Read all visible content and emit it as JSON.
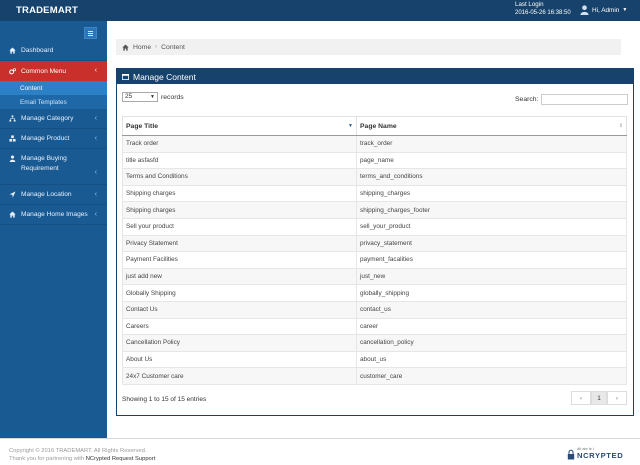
{
  "app": {
    "brand": "TRADEMART"
  },
  "header": {
    "last_login_label": "Last Login",
    "last_login_time": "2016-05-26 16:38:50",
    "user_label": "Hi, Admin"
  },
  "sidebar": {
    "items": [
      {
        "label": "Dashboard",
        "icon": "home-icon"
      },
      {
        "label": "Common Menu",
        "icon": "cogs-icon",
        "active": true,
        "children": [
          {
            "label": "Content"
          },
          {
            "label": "Email Templates"
          }
        ]
      },
      {
        "label": "Manage Category",
        "icon": "sitemap-icon"
      },
      {
        "label": "Manage Product",
        "icon": "cubes-icon"
      },
      {
        "label": "Manage Buying Requirement",
        "icon": "user-icon"
      },
      {
        "label": "Manage Location",
        "icon": "location-arrow-icon"
      },
      {
        "label": "Manage Home Images",
        "icon": "home-icon"
      }
    ]
  },
  "breadcrumb": {
    "home": "Home",
    "current": "Content"
  },
  "panel": {
    "title": "Manage Content",
    "length_value": "25",
    "length_suffix": "records",
    "search_label": "Search:",
    "columns": [
      "Page Title",
      "Page Name"
    ],
    "rows": [
      [
        "Track order",
        "track_order"
      ],
      [
        "title asfasfd",
        "page_name"
      ],
      [
        "Terms and Conditions",
        "terms_and_conditions"
      ],
      [
        "Shipping charges",
        "shipping_charges"
      ],
      [
        "Shipping charges",
        "shipping_charges_footer"
      ],
      [
        "Sell your product",
        "sell_your_product"
      ],
      [
        "Privacy Statement",
        "privacy_statement"
      ],
      [
        "Payment Facilities",
        "payment_facalities"
      ],
      [
        "just add new",
        "just_new"
      ],
      [
        "Globally Shipping",
        "globally_shipping"
      ],
      [
        "Contact Us",
        "contact_us"
      ],
      [
        "Careers",
        "career"
      ],
      [
        "Cancellation Policy",
        "cancellation_policy"
      ],
      [
        "About Us",
        "about_us"
      ],
      [
        "24x7 Customer care",
        "customer_care"
      ]
    ],
    "info": "Showing 1 to 15 of 15 entries",
    "pagination": {
      "prev": "‹",
      "current": "1",
      "next": "›"
    }
  },
  "footer": {
    "copyright": "Copyright © 2016 TRADEMART. All Rights Reserved.",
    "thanks": "Thank you for partnering with",
    "partner": "NCrypted",
    "support": "Request Support",
    "logo_small": "dit ale le i",
    "logo_big": "NCRYPTED"
  },
  "colors": {
    "topbar": "#16426b",
    "sidebar": "#1a5a93",
    "active": "#c9302c"
  }
}
